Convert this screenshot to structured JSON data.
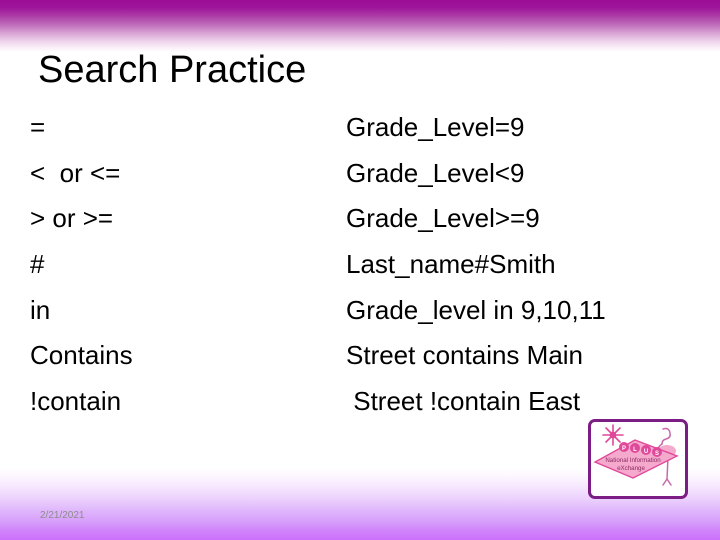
{
  "slide": {
    "title": "Search Practice",
    "date": "2/21/2021",
    "background_color": "#ffffff",
    "accent_top_color": "#9a0e94",
    "accent_bottom_color": "#cc70fb"
  },
  "table": {
    "rows": [
      {
        "operator": "=",
        "example": "Grade_Level=9"
      },
      {
        "operator": "<  or <=",
        "example": "Grade_Level<9"
      },
      {
        "operator": "> or >=",
        "example": "Grade_Level>=9"
      },
      {
        "operator": "#",
        "example": "Last_name#Smith"
      },
      {
        "operator": "in",
        "example": "Grade_level in 9,10,11"
      },
      {
        "operator": "Contains",
        "example": "Street contains Main"
      },
      {
        "operator": "!contain",
        "example": " Street !contain East"
      }
    ]
  },
  "logo": {
    "name": "plus-national-information-exchange-logo",
    "plus_letters": [
      "P",
      "L",
      "U",
      "S"
    ],
    "line1": "National Information",
    "line2": "eXchange",
    "border_color": "#7b1d84",
    "sign_color": "#f4a9cd",
    "accent_color": "#e0499a"
  }
}
